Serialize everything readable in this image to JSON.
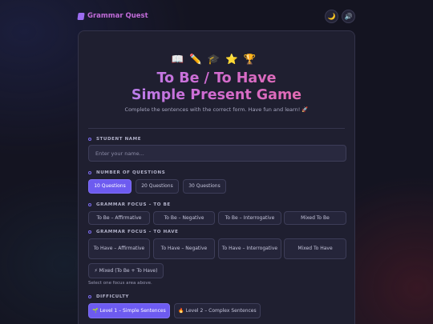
{
  "app": {
    "brand": "Grammar Quest",
    "theme_icon": "🌙",
    "sound_icon": "🔊"
  },
  "hero": {
    "emojis": "📖✏️🎓⭐🏆",
    "title_line1": "To Be / To Have",
    "title_line2": "Simple Present Game",
    "subtitle": "Complete the sentences with the correct form. Have fun and learn! 🚀"
  },
  "student": {
    "label": "STUDENT NAME",
    "placeholder": "Enter your name...",
    "value": ""
  },
  "questions": {
    "label": "NUMBER OF QUESTIONS",
    "options": [
      "10 Questions",
      "20 Questions",
      "30 Questions"
    ],
    "selected": "10 Questions"
  },
  "tobe": {
    "label": "GRAMMAR FOCUS – TO BE",
    "options": [
      "To Be – Affirmative",
      "To Be – Negative",
      "To Be – Interrogative",
      "Mixed To Be"
    ]
  },
  "tohave": {
    "label": "GRAMMAR FOCUS – TO HAVE",
    "options": [
      "To Have – Affirmative",
      "To Have – Negative",
      "To Have – Interrogative",
      "Mixed To Have"
    ],
    "mixed": "⚡ Mixed (To Be + To Have)",
    "hint": "Select one focus area above."
  },
  "difficulty": {
    "label": "DIFFICULTY",
    "options": [
      "🌱 Level 1 – Simple Sentences",
      "🔥 Level 2 – Complex Sentences"
    ],
    "selected": "🌱 Level 1 – Simple Sentences"
  },
  "colors": {
    "accent": "#6d5bf0",
    "card": "#1f1f30",
    "background": "#141421",
    "title_gradient": [
      "#a78bfa",
      "#d06cd4",
      "#ec6aa0"
    ]
  }
}
